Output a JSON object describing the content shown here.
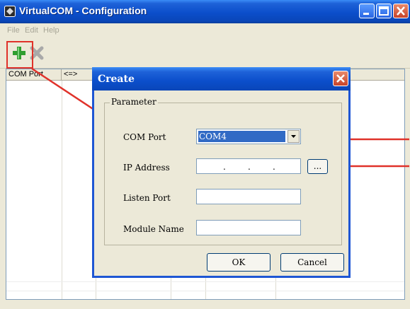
{
  "window": {
    "title": "VirtualCOM - Configuration"
  },
  "menu": {
    "items": [
      "File",
      "Edit",
      "Help"
    ]
  },
  "toolbar": {
    "icons": [
      "add-icon",
      "delete-icon"
    ]
  },
  "list": {
    "columns": [
      "COM Port",
      "<=>"
    ]
  },
  "dialog": {
    "title": "Create",
    "group_label": "Parameter",
    "com_port_label": "COM Port",
    "com_port_value": "COM4",
    "ip_label": "IP Address",
    "ip_dots": [
      ".",
      ".",
      "."
    ],
    "browse_label": "...",
    "listen_port_label": "Listen Port",
    "module_name_label": "Module Name",
    "ok_label": "OK",
    "cancel_label": "Cancel"
  },
  "colors": {
    "titlebar": "#0b4ecb",
    "highlight": "#e0322a",
    "selection": "#316ac5"
  }
}
